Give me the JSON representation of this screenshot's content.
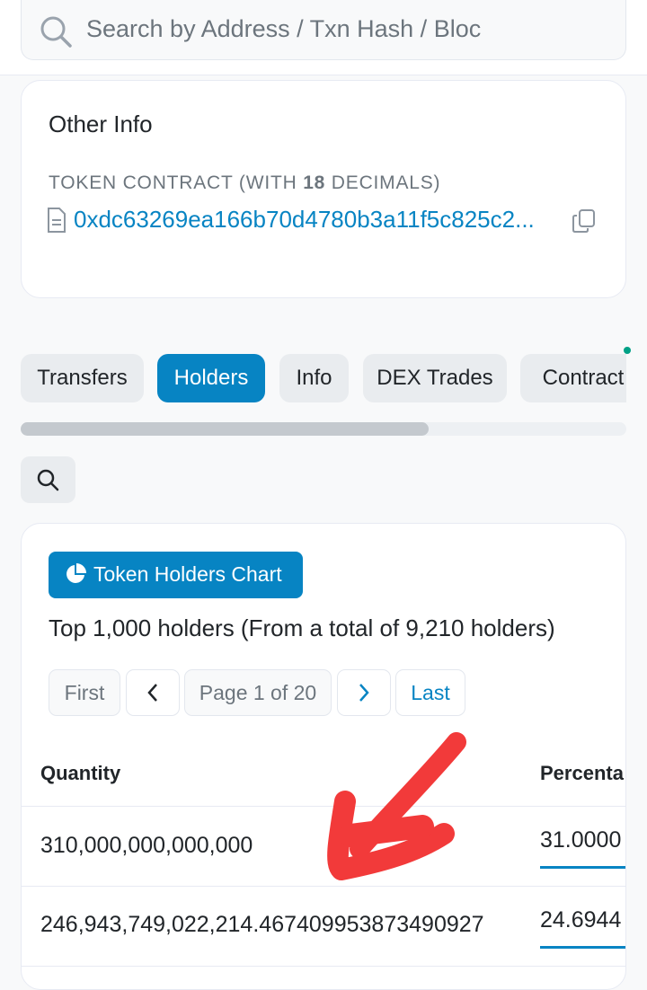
{
  "search": {
    "placeholder": "Search by Address / Txn Hash / Bloc"
  },
  "other_info": {
    "title": "Other Info",
    "contract_label_pre": "TOKEN CONTRACT (WITH ",
    "decimals": "18",
    "contract_label_post": " DECIMALS)",
    "address": "0xdc63269ea166b70d4780b3a11f5c825c2..."
  },
  "tabs": [
    "Transfers",
    "Holders",
    "Info",
    "DEX Trades",
    "Contract"
  ],
  "holders": {
    "chart_button": "Token Holders Chart",
    "summary": "Top 1,000 holders (From a total of 9,210 holders)",
    "pagination": {
      "first": "First",
      "page": "Page 1 of 20",
      "last": "Last"
    },
    "columns": {
      "quantity": "Quantity",
      "percentage": "Percenta"
    },
    "rows": [
      {
        "quantity": "310,000,000,000,000",
        "percentage": "31.0000"
      },
      {
        "quantity": "246,943,749,022,214.467409953873490927",
        "percentage": "24.6944"
      }
    ]
  },
  "colors": {
    "accent": "#0784c3",
    "annotation_arrow": "#f23a3a"
  }
}
